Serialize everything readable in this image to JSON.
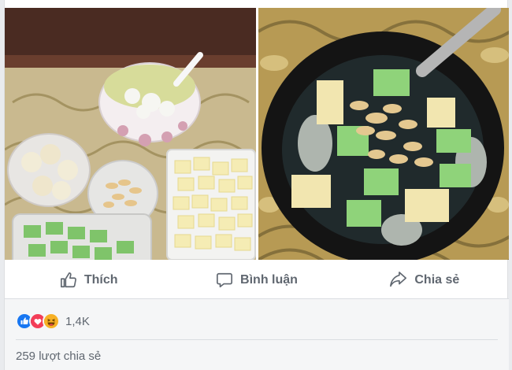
{
  "post": {
    "images": [
      {
        "icon": "dessert-ingredients-photo"
      },
      {
        "icon": "dessert-bowl-photo"
      }
    ]
  },
  "actions": {
    "like": {
      "label": "Thích",
      "icon": "like-icon"
    },
    "comment": {
      "label": "Bình luận",
      "icon": "comment-icon"
    },
    "share": {
      "label": "Chia sẻ",
      "icon": "share-icon"
    }
  },
  "reactions": {
    "types": [
      "like",
      "love",
      "haha"
    ],
    "count": "1,4K",
    "colors": {
      "like": "#1877f2",
      "love": "#f33e58",
      "haha": "#f7b125"
    }
  },
  "shares": {
    "text": "259 lượt chia sẻ"
  }
}
